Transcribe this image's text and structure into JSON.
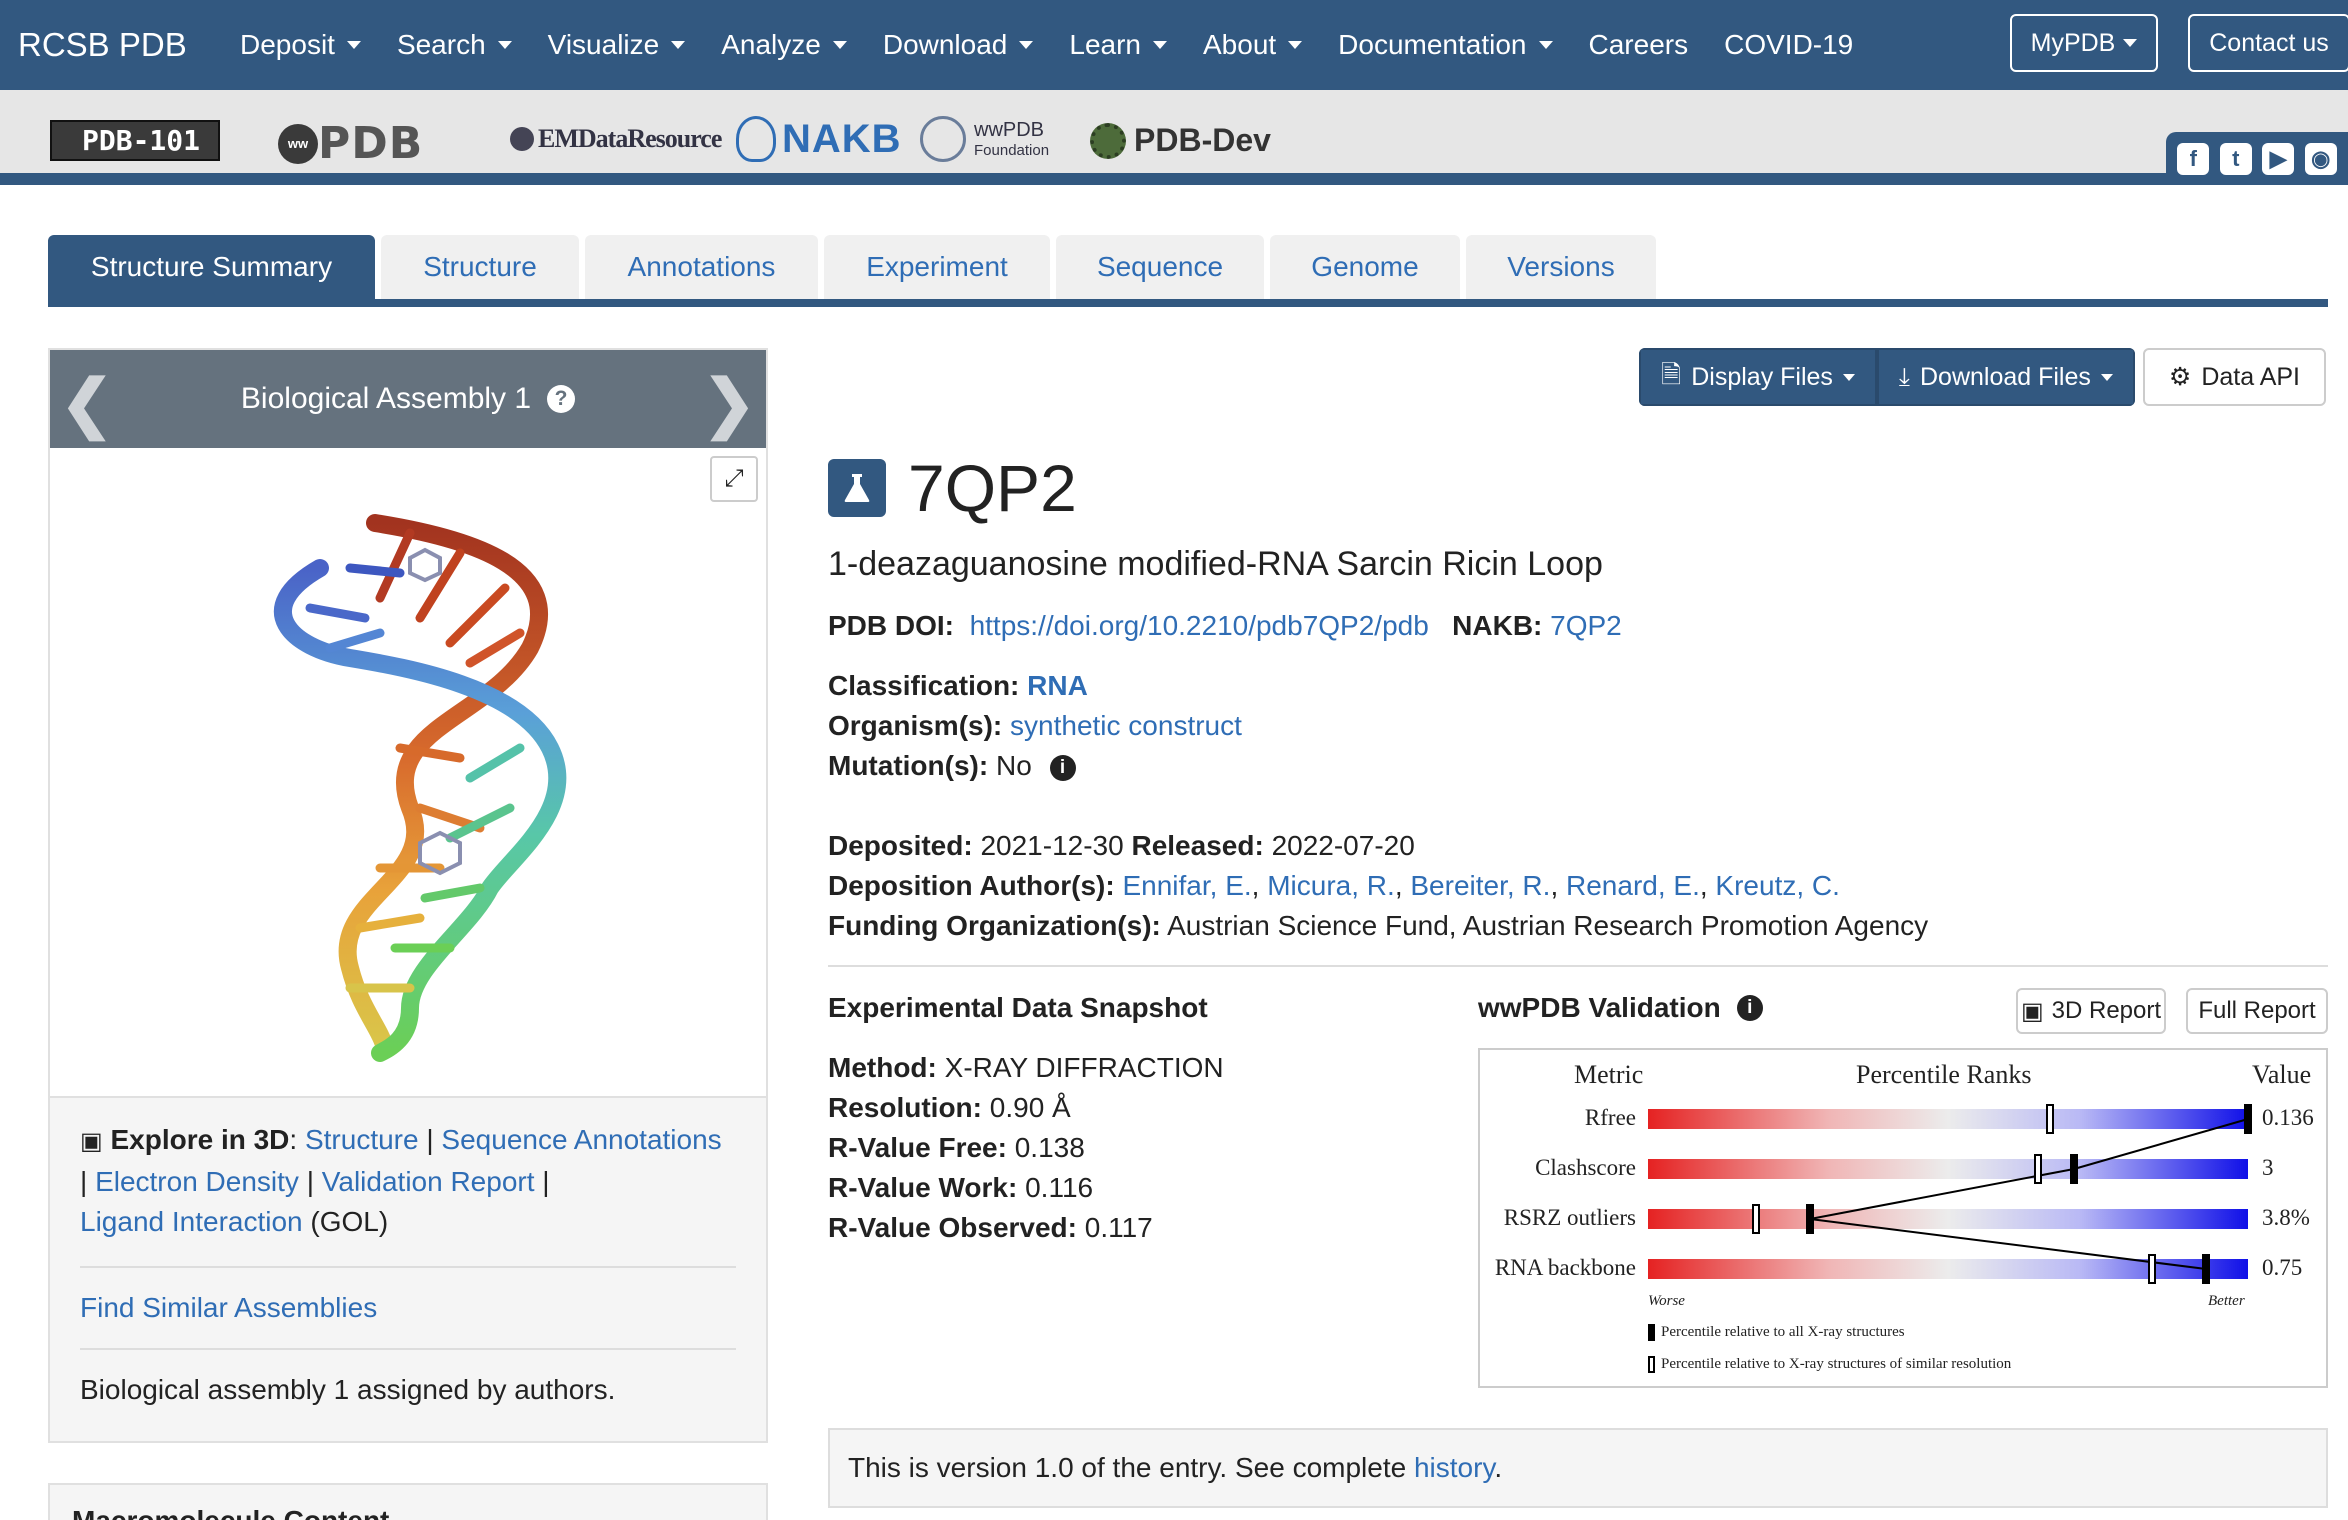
{
  "topnav": {
    "brand": "RCSB PDB",
    "items": [
      "Deposit",
      "Search",
      "Visualize",
      "Analyze",
      "Download",
      "Learn",
      "About",
      "Documentation",
      "Careers",
      "COVID-19"
    ],
    "mypdb": "MyPDB",
    "contact": "Contact us"
  },
  "logobar": {
    "pdb101": "PDB-101",
    "wwpdb": "PDB",
    "emdata": "EMDataResource",
    "nakb": "NAKB",
    "wwpdb_foundation": "wwPDB",
    "wwpdb_foundation_sub": "Foundation",
    "pdbdev": "PDB-Dev"
  },
  "tabs": [
    "Structure Summary",
    "Structure",
    "Annotations",
    "Experiment",
    "Sequence",
    "Genome",
    "Versions"
  ],
  "leftpanel": {
    "assembly_title": "Biological Assembly 1",
    "explore_label": "Explore in 3D",
    "explore_links": {
      "structure": "Structure",
      "sequence_annotations": "Sequence Annotations",
      "electron_density": "Electron Density",
      "validation_report": "Validation Report",
      "ligand_interaction": "Ligand Interaction",
      "ligand_code": "(GOL)"
    },
    "find_similar": "Find Similar Assemblies",
    "assembly_note": "Biological assembly 1 assigned by authors.",
    "next_section": "Macromolecule Content"
  },
  "actions": {
    "display_files": "Display Files",
    "download_files": "Download Files",
    "data_api": "Data API"
  },
  "entry": {
    "id": "7QP2",
    "title": "1-deazaguanosine modified-RNA Sarcin Ricin Loop",
    "doi_label": "PDB DOI:",
    "doi": "https://doi.org/10.2210/pdb7QP2/pdb",
    "nakb_label": "NAKB:",
    "nakb": "7QP2",
    "classification_label": "Classification:",
    "classification": "RNA",
    "organism_label": "Organism(s):",
    "organism": "synthetic construct",
    "mutation_label": "Mutation(s):",
    "mutation": "No",
    "deposited_label": "Deposited:",
    "deposited": "2021-12-30",
    "released_label": "Released:",
    "released": "2022-07-20",
    "authors_label": "Deposition Author(s):",
    "authors": [
      "Ennifar, E.",
      "Micura, R.",
      "Bereiter, R.",
      "Renard, E.",
      "Kreutz, C."
    ],
    "funding_label": "Funding Organization(s):",
    "funding": "Austrian Science Fund, Austrian Research Promotion Agency"
  },
  "snapshot": {
    "title": "Experimental Data Snapshot",
    "method_label": "Method:",
    "method": "X-RAY DIFFRACTION",
    "resolution_label": "Resolution:",
    "resolution": "0.90 Å",
    "rfree_label": "R-Value Free:",
    "rfree": "0.138",
    "rwork_label": "R-Value Work:",
    "rwork": "0.116",
    "robs_label": "R-Value Observed:",
    "robs": "0.117"
  },
  "validation": {
    "title": "wwPDB Validation",
    "report3d": "3D Report",
    "full_report": "Full Report",
    "col_metric": "Metric",
    "col_ranks": "Percentile Ranks",
    "col_value": "Value",
    "worse": "Worse",
    "better": "Better",
    "legend_all": "Percentile relative to all X-ray structures",
    "legend_similar": "Percentile relative to X-ray structures of similar resolution",
    "metrics": [
      {
        "name": "Rfree",
        "value": "0.136",
        "pct_all": 100,
        "pct_similar": 67
      },
      {
        "name": "Clashscore",
        "value": "3",
        "pct_all": 71,
        "pct_similar": 65
      },
      {
        "name": "RSRZ outliers",
        "value": "3.8%",
        "pct_all": 27,
        "pct_similar": 18
      },
      {
        "name": "RNA backbone",
        "value": "0.75",
        "pct_all": 93,
        "pct_similar": 84
      }
    ]
  },
  "version_note": {
    "text": "This is version 1.0 of the entry. See complete",
    "link": "history",
    "end": "."
  },
  "colors": {
    "brand": "#325880",
    "link": "#2f6db5",
    "panel_header": "#65727e"
  }
}
